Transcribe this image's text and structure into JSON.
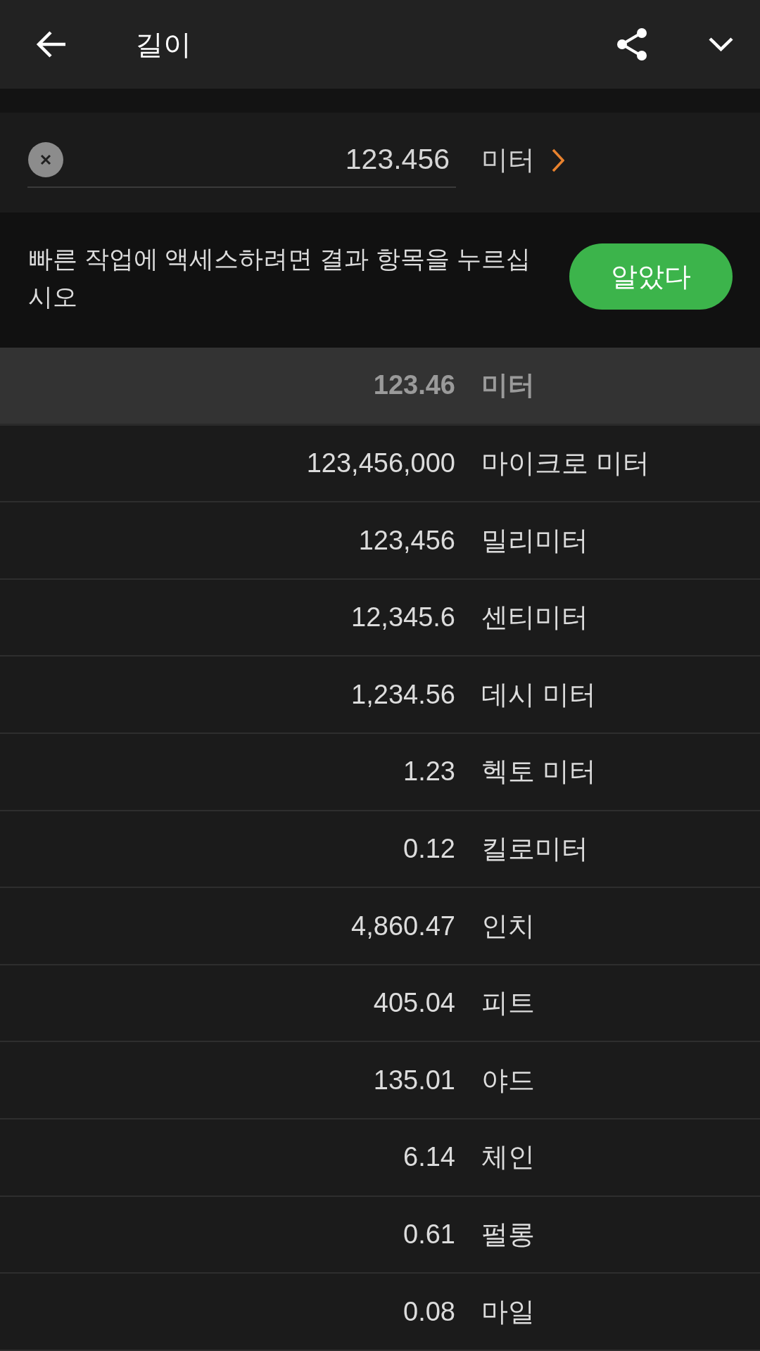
{
  "app_bar": {
    "title": "길이"
  },
  "input": {
    "value": "123.456",
    "unit": "미터"
  },
  "tip": {
    "message": "빠른 작업에 액세스하려면 결과 항목을 누르십시오",
    "button": "알았다"
  },
  "results": [
    {
      "value": "123.46",
      "unit": "미터",
      "selected": true
    },
    {
      "value": "123,456,000",
      "unit": "마이크로 미터",
      "selected": false
    },
    {
      "value": "123,456",
      "unit": "밀리미터",
      "selected": false
    },
    {
      "value": "12,345.6",
      "unit": "센티미터",
      "selected": false
    },
    {
      "value": "1,234.56",
      "unit": "데시 미터",
      "selected": false
    },
    {
      "value": "1.23",
      "unit": "헥토 미터",
      "selected": false
    },
    {
      "value": "0.12",
      "unit": "킬로미터",
      "selected": false
    },
    {
      "value": "4,860.47",
      "unit": "인치",
      "selected": false
    },
    {
      "value": "405.04",
      "unit": "피트",
      "selected": false
    },
    {
      "value": "135.01",
      "unit": "야드",
      "selected": false
    },
    {
      "value": "6.14",
      "unit": "체인",
      "selected": false
    },
    {
      "value": "0.61",
      "unit": "펄롱",
      "selected": false
    },
    {
      "value": "0.08",
      "unit": "마일",
      "selected": false
    }
  ]
}
